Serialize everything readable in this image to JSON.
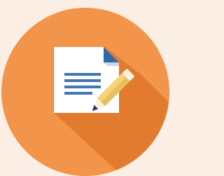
{
  "icon": {
    "name": "document-edit-icon",
    "colors": {
      "background": "#fbeee4",
      "circle": "#f2954a",
      "shadow": "#e27b2e",
      "paper": "#ffffff",
      "paper_fold": "#2f6aa6",
      "paper_fold_light": "#cfd6e0",
      "text_lines": "#3f78b3",
      "pencil_body": "#f6d37a",
      "pencil_edge": "#e9bf5c",
      "pencil_eraser": "#f8f1de",
      "pencil_tip": "#1e3a5f"
    }
  }
}
